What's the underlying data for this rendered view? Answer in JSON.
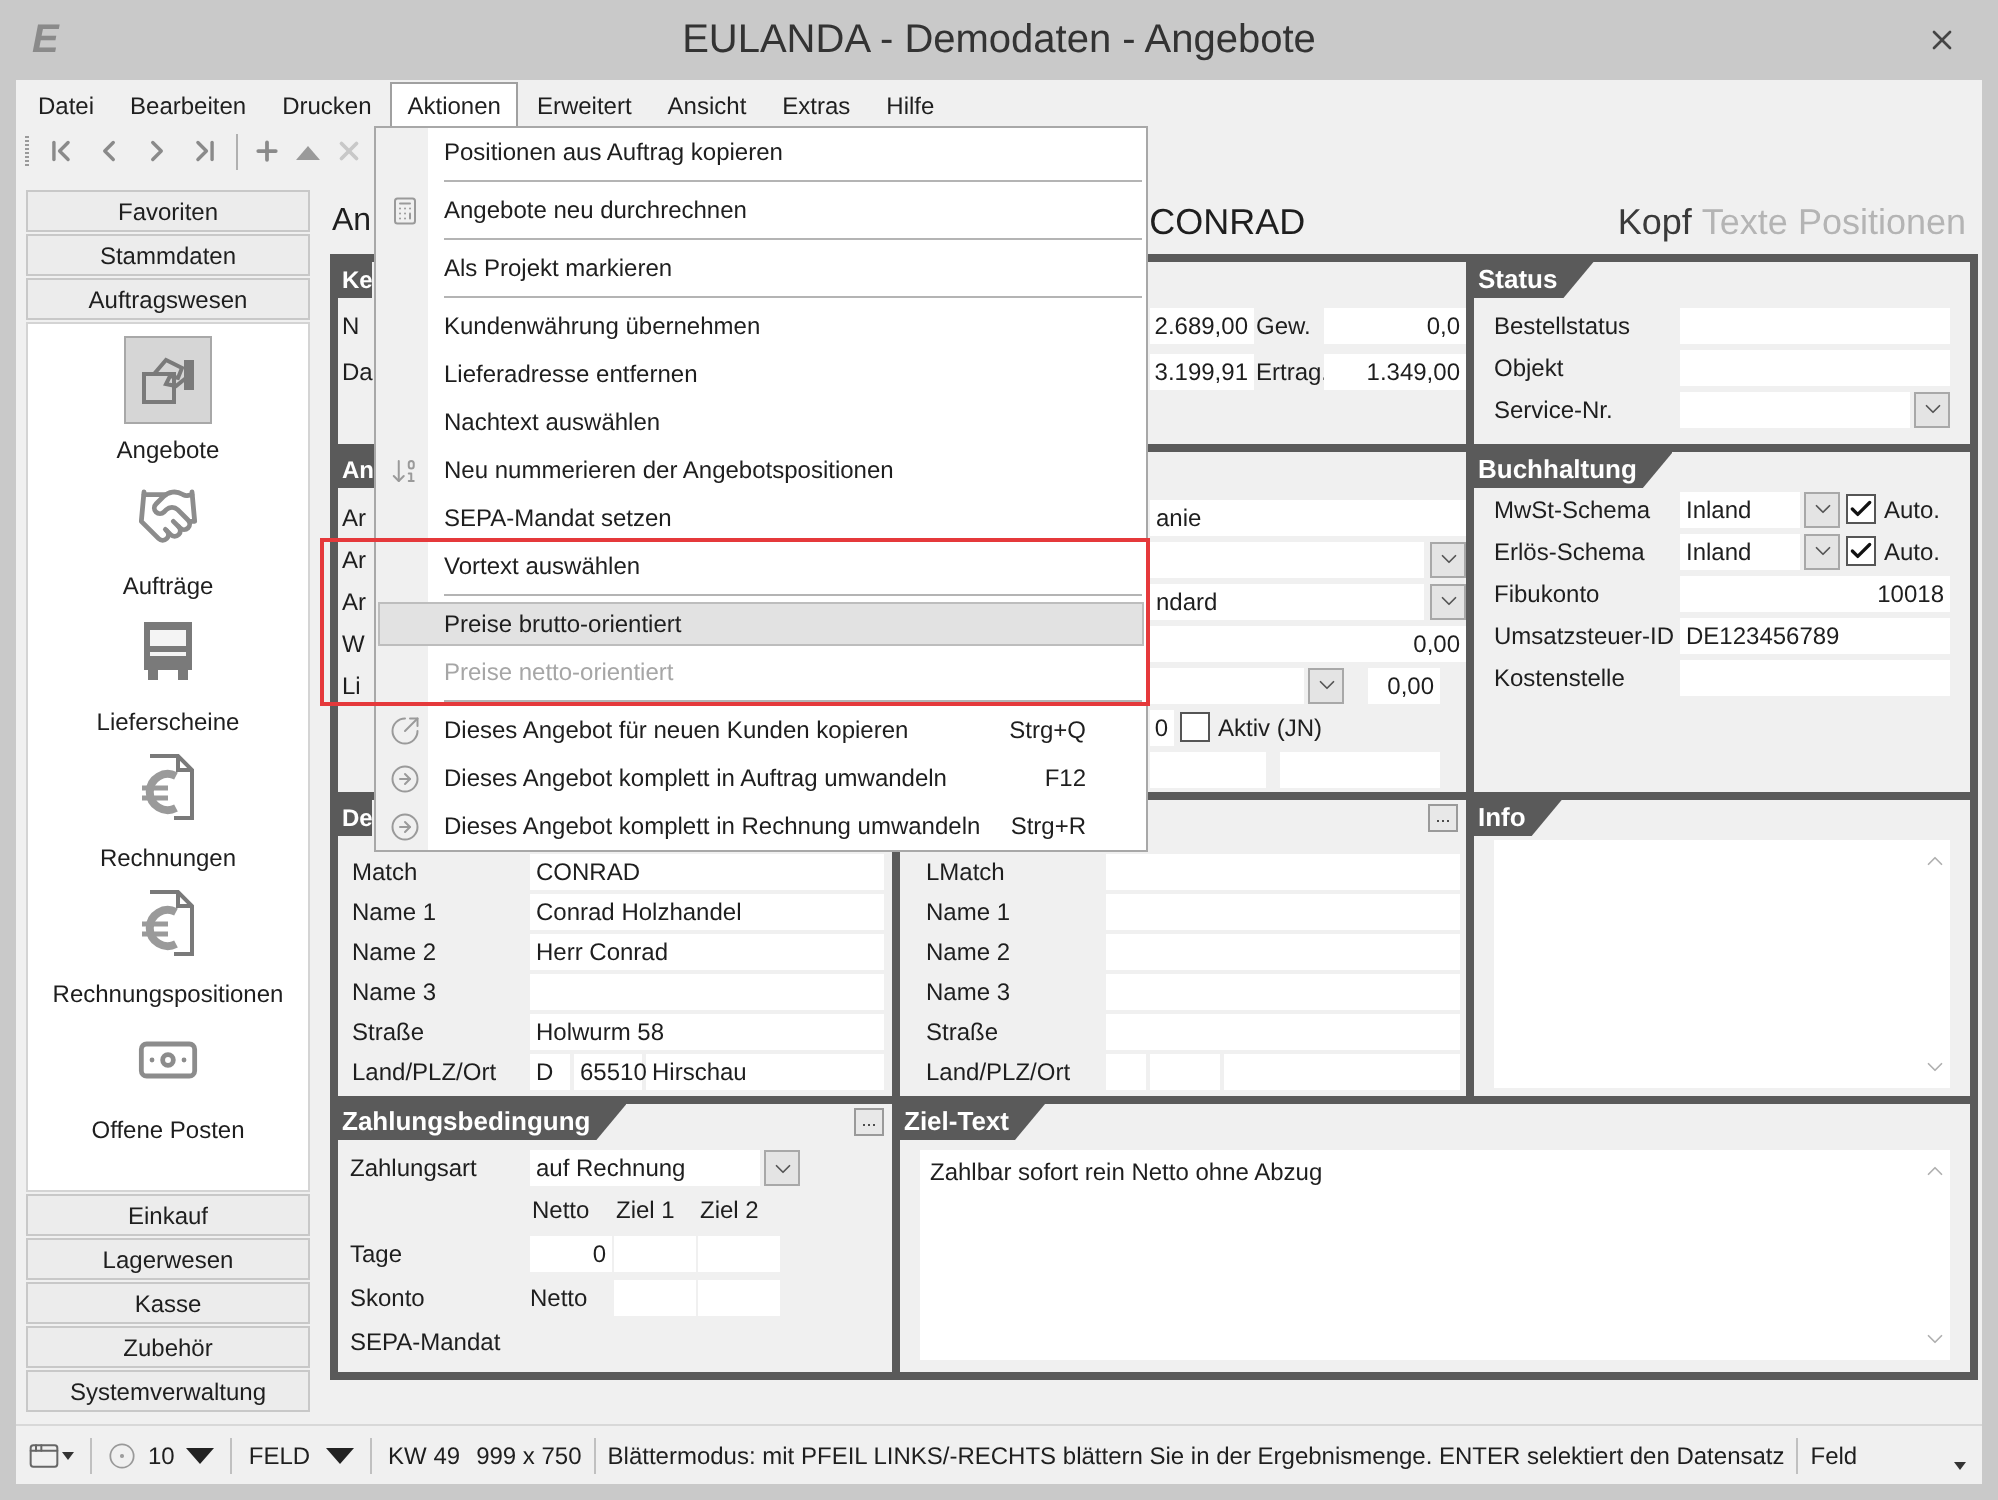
{
  "window": {
    "logo": "E",
    "title": "EULANDA - Demodaten - Angebote"
  },
  "menu_bar": [
    {
      "label": "Datei",
      "selected": false
    },
    {
      "label": "Bearbeiten",
      "selected": false
    },
    {
      "label": "Drucken",
      "selected": false
    },
    {
      "label": "Aktionen",
      "selected": true
    },
    {
      "label": "Erweitert",
      "selected": false
    },
    {
      "label": "Ansicht",
      "selected": false
    },
    {
      "label": "Extras",
      "selected": false
    },
    {
      "label": "Hilfe",
      "selected": false
    }
  ],
  "sidebar": {
    "top_groups": [
      "Favoriten",
      "Stammdaten",
      "Auftragswesen"
    ],
    "items": [
      {
        "label": "Angebote",
        "kind": "offer",
        "selected": true
      },
      {
        "label": "Aufträge",
        "kind": "handshake",
        "selected": false
      },
      {
        "label": "Lieferscheine",
        "kind": "truck",
        "selected": false
      },
      {
        "label": "Rechnungen",
        "kind": "invoice",
        "selected": false
      },
      {
        "label": "Rechnungspositionen",
        "kind": "invoice",
        "selected": false
      },
      {
        "label": "Offene Posten",
        "kind": "money",
        "selected": false
      }
    ],
    "bottom_groups": [
      "Einkauf",
      "Lagerwesen",
      "Kasse",
      "Zubehör",
      "Systemverwaltung"
    ]
  },
  "header": {
    "title": "An",
    "customer": "CONRAD",
    "tabs": [
      {
        "label": "Kopf",
        "selected": true
      },
      {
        "label": "Texte",
        "selected": false
      },
      {
        "label": "Positionen",
        "selected": false
      }
    ]
  },
  "kenndaten": {
    "header": "Ke",
    "rows": [
      {
        "label": "N",
        "value": "2.689,00",
        "label_2": "Gew.",
        "value_2": "0,0"
      },
      {
        "label": "Da",
        "value": "3.199,91",
        "label_2": "Ertrag.",
        "value_2": "1.349,00"
      }
    ]
  },
  "status": {
    "header": "Status",
    "fields": [
      {
        "label": "Bestellstatus",
        "kind": "text"
      },
      {
        "label": "Objekt",
        "kind": "text"
      },
      {
        "label": "Service-Nr.",
        "kind": "dropdown"
      }
    ]
  },
  "anfrage": {
    "header": "An",
    "rows": [
      {
        "label": "Ar",
        "kind": "text",
        "value": "anie"
      },
      {
        "label": "Ar",
        "kind": "dropdown"
      },
      {
        "label": "Ar",
        "kind": "dropdown",
        "value": "ndard"
      },
      {
        "label": "W",
        "kind": "number",
        "value": "0,00"
      },
      {
        "label": "Li",
        "kind": "dropdown_number",
        "value": "0,00"
      },
      {
        "kind": "checkbox",
        "value": "0",
        "checked": false,
        "text": "Aktiv (JN)"
      },
      {
        "kind": "pair"
      }
    ]
  },
  "buchhaltung": {
    "header": "Buchhaltung",
    "fields": [
      {
        "label": "MwSt-Schema",
        "kind": "scheme",
        "value": "Inland",
        "checked": true,
        "check_label": "Auto."
      },
      {
        "label": "Erlös-Schema",
        "kind": "scheme",
        "value": "Inland",
        "checked": true,
        "check_label": "Auto."
      },
      {
        "label": "Fibukonto",
        "kind": "number",
        "value": "10018"
      },
      {
        "label": "Umsatzsteuer-ID",
        "kind": "text",
        "value": "DE123456789"
      },
      {
        "label": "Kostenstelle",
        "kind": "text"
      }
    ]
  },
  "delivery_address": {
    "header": "De",
    "fields": [
      {
        "label": "Match",
        "kind": "text",
        "value": "CONRAD"
      },
      {
        "label": "Name 1",
        "kind": "text",
        "value": "Conrad Holzhandel"
      },
      {
        "label": "Name 2",
        "kind": "text",
        "value": "Herr Conrad"
      },
      {
        "label": "Name 3",
        "kind": "text"
      },
      {
        "label": "Straße",
        "kind": "text",
        "value": "Holwurm 58"
      },
      {
        "label": "Land/PLZ/Ort",
        "kind": "address",
        "parts": [
          "D",
          "65510",
          "Hirschau"
        ]
      }
    ]
  },
  "second_address": {
    "more_button": "...",
    "fields": [
      {
        "label": "LMatch",
        "kind": "text"
      },
      {
        "label": "Name 1",
        "kind": "text"
      },
      {
        "label": "Name 2",
        "kind": "text"
      },
      {
        "label": "Name 3",
        "kind": "text"
      },
      {
        "label": "Straße",
        "kind": "text"
      },
      {
        "label": "Land/PLZ/Ort",
        "kind": "address"
      }
    ]
  },
  "info": {
    "header": "Info"
  },
  "zahlung": {
    "header": "Zahlungsbedingung",
    "more_button": "...",
    "type_label": "Zahlungsart",
    "type_value": "auf Rechnung",
    "columns": [
      "Netto",
      "Ziel 1",
      "Ziel 2"
    ],
    "rows": [
      {
        "label": "Tage",
        "kind": "fields",
        "netto": "0"
      },
      {
        "label": "Skonto",
        "kind": "text",
        "netto": "Netto"
      },
      {
        "label": "SEPA-Mandat",
        "kind": "label"
      }
    ]
  },
  "ziel_text": {
    "header": "Ziel-Text",
    "text": "Zahlbar sofort rein Netto ohne Abzug"
  },
  "context_menu": {
    "items": [
      {
        "label": "Positionen aus Auftrag kopieren",
        "kind": "plain",
        "selected": false,
        "disabled": false,
        "separator_after": true
      },
      {
        "label": "Angebote neu durchrechnen",
        "kind": "calculator",
        "selected": false,
        "disabled": false,
        "separator_after": true
      },
      {
        "label": "Als Projekt markieren",
        "kind": "plain",
        "selected": false,
        "disabled": false,
        "separator_after": true
      },
      {
        "label": "Kundenwährung übernehmen",
        "kind": "plain",
        "selected": false,
        "disabled": false,
        "separator_after": false
      },
      {
        "label": "Lieferadresse entfernen",
        "kind": "plain",
        "selected": false,
        "disabled": false,
        "separator_after": false
      },
      {
        "label": "Nachtext auswählen",
        "kind": "plain",
        "selected": false,
        "disabled": false,
        "separator_after": false
      },
      {
        "label": "Neu nummerieren der Angebotspositionen",
        "kind": "renumber",
        "selected": false,
        "disabled": false,
        "separator_after": false
      },
      {
        "label": "SEPA-Mandat setzen",
        "kind": "plain",
        "selected": false,
        "disabled": false,
        "separator_after": false
      },
      {
        "label": "Vortext auswählen",
        "kind": "plain",
        "selected": false,
        "disabled": false,
        "separator_after": true
      },
      {
        "label": "Preise brutto-orientiert",
        "kind": "plain",
        "selected": true,
        "disabled": false,
        "separator_after": false
      },
      {
        "label": "Preise netto-orientiert",
        "kind": "plain",
        "selected": false,
        "disabled": true,
        "separator_after": true
      },
      {
        "label": "Dieses Angebot für neuen Kunden kopieren",
        "kind": "copy",
        "shortcut": "Strg+Q",
        "selected": false,
        "disabled": false,
        "separator_after": false
      },
      {
        "label": "Dieses Angebot komplett in Auftrag umwandeln",
        "kind": "convert",
        "shortcut": "F12",
        "selected": false,
        "disabled": false,
        "separator_after": false
      },
      {
        "label": "Dieses Angebot komplett in Rechnung umwandeln",
        "kind": "convert",
        "shortcut": "Strg+R",
        "selected": false,
        "disabled": false,
        "separator_after": false
      }
    ]
  },
  "status_bar": {
    "page_size": "10",
    "mode": "FELD",
    "week": "KW 49",
    "resolution": "999 x 750",
    "message": "Blättermodus: mit PFEIL LINKS/-RECHTS blättern Sie in der Ergebnismenge. ENTER selektiert den Datensatz",
    "field": "Feld"
  }
}
